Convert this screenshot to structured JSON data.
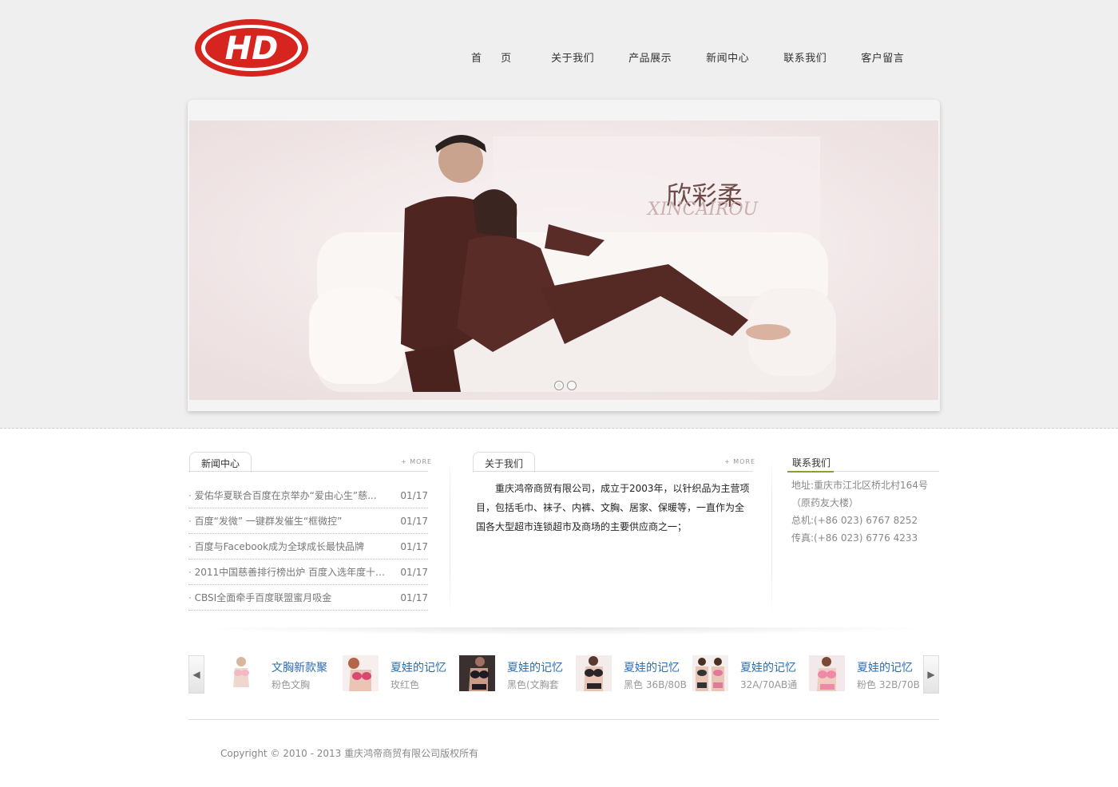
{
  "logo": {
    "text": "HD",
    "color": "#d6241f"
  },
  "nav": {
    "items": [
      "首 页",
      "关于我们",
      "产品展示",
      "新闻中心",
      "联系我们",
      "客户留言"
    ]
  },
  "banner": {
    "title_cn": "欣彩柔",
    "title_en": "XINCAIROU",
    "slides": 2,
    "active_slide": 1
  },
  "news": {
    "tab_label": "新闻中心",
    "more_label": "+ MORE",
    "items": [
      {
        "title": "爱佑华夏联合百度在京举办“爱由心生”慈...",
        "date": "01/17"
      },
      {
        "title": "百度“发微” 一键群发催生“框微控”",
        "date": "01/17"
      },
      {
        "title": "百度与Facebook成为全球成长最快品牌",
        "date": "01/17"
      },
      {
        "title": "2011中国慈善排行榜出炉 百度入选年度十大...",
        "date": "01/17"
      },
      {
        "title": "CBSI全面牵手百度联盟蜜月吸金",
        "date": "01/17"
      }
    ]
  },
  "about": {
    "tab_label": "关于我们",
    "more_label": "+ MORE",
    "text": "重庆鸿帝商贸有限公司，成立于2003年，以针织品为主营项目，包括毛巾、袜子、内裤、文胸、居家、保暖等，一直作为全国各大型超市连锁超市及商场的主要供应商之一；"
  },
  "contact": {
    "tab_label": "联系我们",
    "address": "地址:重庆市江北区桥北村164号（原药友大楼）",
    "phone": "总机:(+86 023) 6767 8252",
    "fax": "传真:(+86 023) 6776 4233",
    "accent_color": "#8aa034"
  },
  "products": [
    {
      "name": "文胸新款聚",
      "desc": "粉色文胸"
    },
    {
      "name": "夏娃的记忆",
      "desc": "玫红色"
    },
    {
      "name": "夏娃的记忆",
      "desc": "黑色(文胸套"
    },
    {
      "name": "夏娃的记忆",
      "desc": "黑色 36B/80B"
    },
    {
      "name": "夏娃的记忆",
      "desc": "32A/70AB通"
    },
    {
      "name": "夏娃的记忆",
      "desc": "粉色 32B/70B"
    }
  ],
  "carousel": {
    "prev_icon": "triangle-left-icon",
    "next_icon": "triangle-right-icon"
  },
  "footer": {
    "copyright": "Copyright © 2010 - 2013 重庆鸿帝商贸有限公司版权所有"
  }
}
